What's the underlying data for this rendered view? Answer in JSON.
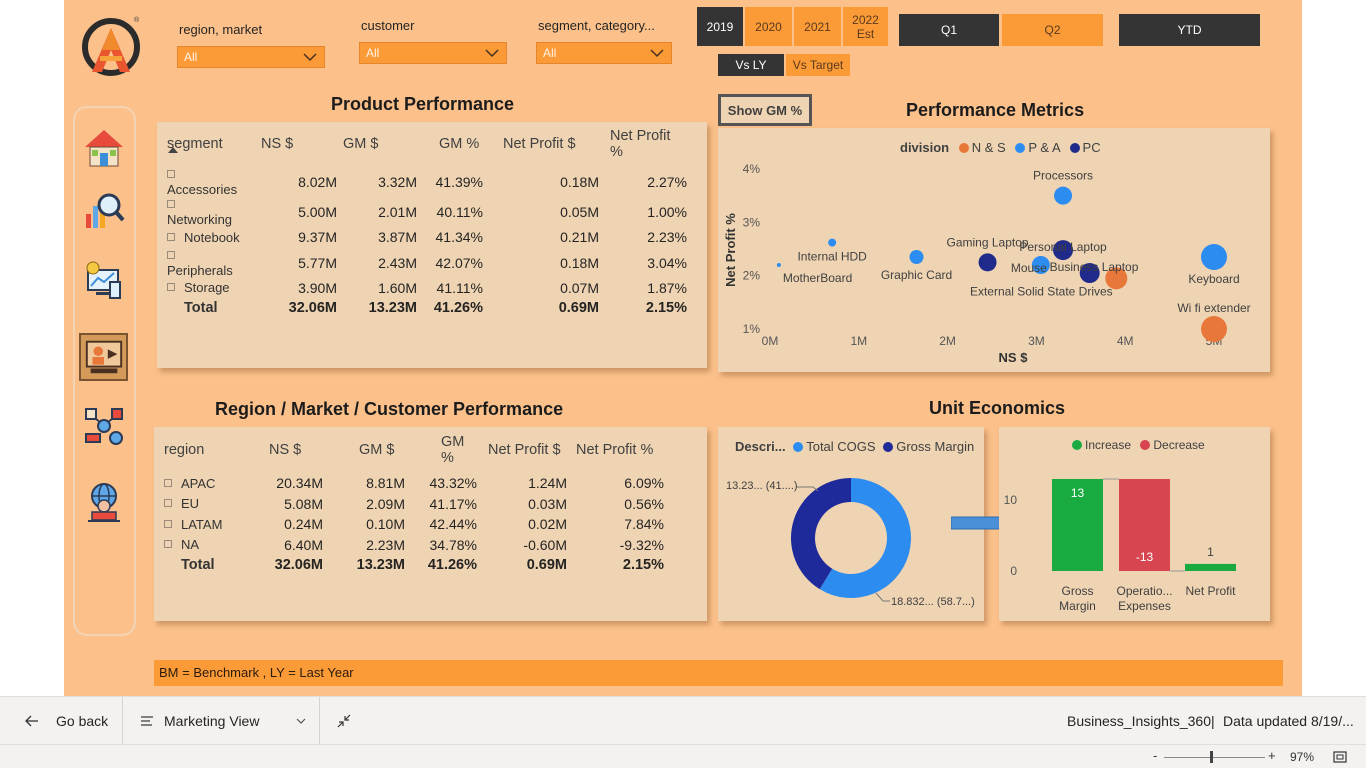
{
  "filters": {
    "region_market": {
      "label": "region, market",
      "value": "All"
    },
    "customer": {
      "label": "customer",
      "value": "All"
    },
    "segment_category": {
      "label": "segment, category...",
      "value": "All"
    }
  },
  "years": [
    {
      "label": "2019"
    },
    {
      "label": "2020"
    },
    {
      "label": "2021"
    },
    {
      "label": "2022\nEst"
    }
  ],
  "year_2022_line1": "2022",
  "year_2022_line2": "Est",
  "quarters": {
    "q1": "Q1",
    "q2": "Q2",
    "ytd": "YTD"
  },
  "compare": {
    "vs_ly": "Vs LY",
    "vs_target": "Vs Target"
  },
  "show_gm_button": "Show GM %",
  "product_performance": {
    "title": "Product Performance",
    "columns": [
      "segment",
      "NS $",
      "GM $",
      "GM %",
      "Net Profit $",
      "Net Profit %"
    ],
    "rows": [
      [
        "Accessories",
        "8.02M",
        "3.32M",
        "41.39%",
        "0.18M",
        "2.27%"
      ],
      [
        "Networking",
        "5.00M",
        "2.01M",
        "40.11%",
        "0.05M",
        "1.00%"
      ],
      [
        "Notebook",
        "9.37M",
        "3.87M",
        "41.34%",
        "0.21M",
        "2.23%"
      ],
      [
        "Peripherals",
        "5.77M",
        "2.43M",
        "42.07%",
        "0.18M",
        "3.04%"
      ],
      [
        "Storage",
        "3.90M",
        "1.60M",
        "41.11%",
        "0.07M",
        "1.87%"
      ]
    ],
    "total": [
      "Total",
      "32.06M",
      "13.23M",
      "41.26%",
      "0.69M",
      "2.15%"
    ]
  },
  "region_performance": {
    "title": "Region / Market / Customer Performance",
    "columns": [
      "region",
      "NS $",
      "GM $",
      "GM %",
      "Net Profit $",
      "Net Profit %"
    ],
    "rows": [
      [
        "APAC",
        "20.34M",
        "8.81M",
        "43.32%",
        "1.24M",
        "6.09%"
      ],
      [
        "EU",
        "5.08M",
        "2.09M",
        "41.17%",
        "0.03M",
        "0.56%"
      ],
      [
        "LATAM",
        "0.24M",
        "0.10M",
        "42.44%",
        "0.02M",
        "7.84%"
      ],
      [
        "NA",
        "6.40M",
        "2.23M",
        "34.78%",
        "-0.60M",
        "-9.32%"
      ]
    ],
    "total": [
      "Total",
      "32.06M",
      "13.23M",
      "41.26%",
      "0.69M",
      "2.15%"
    ]
  },
  "performance_metrics": {
    "title": "Performance Metrics",
    "legend_title": "division",
    "legend": [
      {
        "name": "N & S",
        "color": "#e8783a"
      },
      {
        "name": "P & A",
        "color": "#2d8cf0"
      },
      {
        "name": "PC",
        "color": "#1f2a8a"
      }
    ]
  },
  "unit_economics": {
    "title": "Unit Economics",
    "donut_legend_title": "Descri...",
    "donut_label_gm": "13.23... (41....)",
    "donut_label_cogs": "18.832... (58.7...)",
    "waterfall_legend": [
      {
        "name": "Increase",
        "color": "#1aab40"
      },
      {
        "name": "Decrease",
        "color": "#d64550"
      }
    ]
  },
  "chart_data": [
    {
      "type": "scatter",
      "title": "Performance Metrics",
      "xlabel": "NS $",
      "ylabel": "Net Profit %",
      "x_ticks": [
        "0M",
        "1M",
        "2M",
        "3M",
        "4M",
        "5M"
      ],
      "y_ticks": [
        "1%",
        "2%",
        "3%",
        "4%"
      ],
      "xlim": [
        0,
        5
      ],
      "ylim": [
        1,
        4
      ],
      "points": [
        {
          "label": "Processors",
          "x": 3.3,
          "y": 3.5,
          "series": "P & A",
          "color": "#2d8cf0",
          "r": 9
        },
        {
          "label": "Internal HDD",
          "x": 0.7,
          "y": 2.62,
          "series": "P & A",
          "color": "#2d8cf0",
          "r": 4
        },
        {
          "label": "MotherBoard",
          "x": 0.1,
          "y": 2.2,
          "series": "P & A",
          "color": "#2d8cf0",
          "r": 2
        },
        {
          "label": "Graphic Card",
          "x": 1.65,
          "y": 2.35,
          "series": "P & A",
          "color": "#2d8cf0",
          "r": 7
        },
        {
          "label": "Gaming Laptop",
          "x": 2.45,
          "y": 2.25,
          "series": "PC",
          "color": "#1f2a8a",
          "r": 9
        },
        {
          "label": "Personal Laptop",
          "x": 3.3,
          "y": 2.48,
          "series": "PC",
          "color": "#1f2a8a",
          "r": 10
        },
        {
          "label": "Mouse",
          "x": 3.05,
          "y": 2.2,
          "series": "P & A",
          "color": "#2d8cf0",
          "r": 9
        },
        {
          "label": "Business Laptop",
          "x": 3.6,
          "y": 2.05,
          "series": "PC",
          "color": "#1f2a8a",
          "r": 10
        },
        {
          "label": "External Solid State Drives",
          "x": 3.9,
          "y": 1.95,
          "series": "N & S",
          "color": "#e8783a",
          "r": 11
        },
        {
          "label": "Keyboard",
          "x": 5.0,
          "y": 2.35,
          "series": "P & A",
          "color": "#2d8cf0",
          "r": 13
        },
        {
          "label": "Wi fi extender",
          "x": 5.0,
          "y": 1.0,
          "series": "N & S",
          "color": "#e8783a",
          "r": 13
        }
      ]
    },
    {
      "type": "pie",
      "title": "",
      "legend_title": "Descri...",
      "slices": [
        {
          "name": "Total COGS",
          "value": 18.832,
          "percent": 58.74,
          "color": "#2d8cf0",
          "label": "18.832... (58.7...)"
        },
        {
          "name": "Gross Margin",
          "value": 13.23,
          "percent": 41.26,
          "color": "#1f2a9a",
          "label": "13.23... (41....)"
        }
      ]
    },
    {
      "type": "bar",
      "title": "",
      "categories": [
        "Gross Margin",
        "Operatio... Expenses",
        "Net Profit"
      ],
      "values": [
        13,
        -13,
        1
      ],
      "data_labels": [
        "13",
        "-13",
        "1"
      ],
      "ylim": [
        0,
        15
      ],
      "y_ticks": [
        "0",
        "10"
      ]
    }
  ],
  "footnote": "BM = Benchmark , LY = Last Year",
  "bottom_bar": {
    "go_back": "Go back",
    "page_name": "Marketing View",
    "report_name": "Business_Insights_360",
    "separator": "|",
    "data_updated": "Data updated 8/19/..."
  },
  "status_bar": {
    "zoom_minus": "-",
    "zoom_plus": "+",
    "zoom_level": "97%"
  }
}
